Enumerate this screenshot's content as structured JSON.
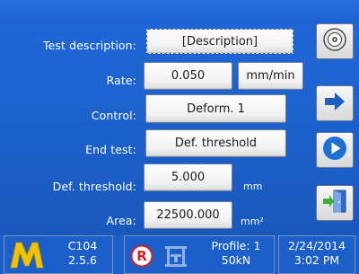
{
  "form": {
    "test_description": {
      "label": "Test description:",
      "value": "[Description]"
    },
    "rate": {
      "label": "Rate:",
      "value": "0.050",
      "unit": "mm/min"
    },
    "control": {
      "label": "Control:",
      "value": "Deform. 1"
    },
    "end_test": {
      "label": "End test:",
      "value": "Def. threshold"
    },
    "def_threshold": {
      "label": "Def. threshold:",
      "value": "5.000",
      "unit": "mm"
    },
    "area": {
      "label": "Area:",
      "value": "22500.000",
      "unit": "mm²"
    }
  },
  "side_buttons": [
    {
      "icon": "disc-icon"
    },
    {
      "icon": "arrow-right-icon"
    },
    {
      "icon": "play-circle-icon"
    },
    {
      "icon": "exit-door-icon"
    }
  ],
  "status_bar": {
    "logo_letter": "M",
    "machine_id": "C104",
    "version": "2.5.6",
    "r_badge": "R",
    "profile": "Profile: 1",
    "load_cell": "50kN",
    "date": "2/24/2014",
    "time": "3:02 PM"
  },
  "colors": {
    "screen_blue": "#1c5fc8",
    "logo_yellow": "#f2c200",
    "play_blue": "#1f6fd6",
    "r_red": "#d0202a"
  }
}
